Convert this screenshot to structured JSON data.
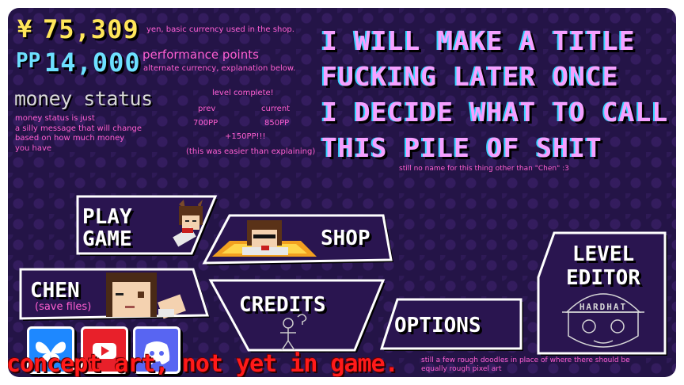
{
  "currency": {
    "yen_symbol": "¥",
    "yen_value": "75,309",
    "yen_note": "yen, basic currency used in the shop.",
    "pp_symbol": "PP",
    "pp_value": "14,000",
    "pp_title": "performance points",
    "pp_note": "alternate currency, explanation below."
  },
  "money_status": {
    "title": "money status",
    "note_lines": [
      "money status is just",
      "a silly message that will change",
      "based on how much money",
      "you have"
    ]
  },
  "level_info": {
    "heading": "level complete!",
    "prev_label": "prev",
    "prev_value": "700PP",
    "current_label": "current",
    "current_value": "850PP",
    "gain": "+150PP!!!",
    "aside": "(this was easier than explaining)"
  },
  "game_title": {
    "lines": [
      "I WILL MAKE A TITLE",
      "FUCKING LATER ONCE",
      "I DECIDE WHAT TO CALL",
      "THIS PILE OF SHIT"
    ],
    "note": "still no name for this thing other than \"Chen\" :3"
  },
  "menu": {
    "play_line1": "PLAY",
    "play_line2": "GAME",
    "shop": "SHOP",
    "chen": "CHEN",
    "chen_sub": "(save files)",
    "credits": "CREDITS",
    "options": "OPTIONS",
    "editor_line1": "LEVEL",
    "editor_line2": "EDITOR",
    "hardhat": "HARDHAT"
  },
  "socials": [
    {
      "icon": "bluesky-butterfly-icon",
      "color": "#1e88ff"
    },
    {
      "icon": "youtube-play-icon",
      "color": "#e8202a"
    },
    {
      "icon": "discord-icon",
      "color": "#5865f2"
    }
  ],
  "footer": {
    "concept_text": "concept art, not yet in game.",
    "doodle_note_line1": "still a few rough doodles in place of where there should be",
    "doodle_note_line2": "equally rough pixel art"
  },
  "colors": {
    "background": "#241447",
    "yen": "#ffe65a",
    "pp": "#6de0ff",
    "note_pink": "#ff5fd2",
    "title_pink": "#f6a0ff",
    "concept_red": "#ff1a1a"
  }
}
